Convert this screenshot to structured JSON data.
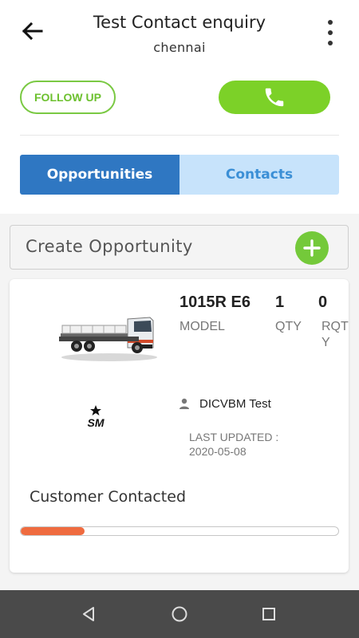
{
  "header": {
    "title": "Test Contact enquiry",
    "subtitle": "chennai",
    "back_icon": "arrow-left-icon",
    "menu_icon": "more-vertical-icon"
  },
  "actions": {
    "follow_up_label": "FOLLOW UP",
    "call_icon": "phone-icon"
  },
  "tabs": [
    {
      "label": "Opportunities",
      "active": true
    },
    {
      "label": "Contacts",
      "active": false
    }
  ],
  "create_opportunity": {
    "label": "Create Opportunity",
    "add_icon": "plus-circle-icon"
  },
  "opportunity": {
    "image": "truck-image",
    "model_value": "1015R E6",
    "model_label": "MODEL",
    "qty_value": "1",
    "qty_label": "QTY",
    "rqty_value": "0",
    "rqty_label": "RQT\nY",
    "brand_logo_text": "SM",
    "owner": "DICVBM Test",
    "last_updated_label": "LAST UPDATED :",
    "last_updated_value": "2020-05-08",
    "status": "Customer Contacted",
    "progress_fraction": 0.2
  },
  "colors": {
    "accent_green": "#74c93a",
    "tab_active": "#2f77c2",
    "tab_inactive": "#c7e3fb",
    "progress": "#ef6b3f"
  },
  "navbar": {
    "back_icon": "triangle-back-icon",
    "home_icon": "circle-home-icon",
    "recents_icon": "square-recents-icon"
  }
}
